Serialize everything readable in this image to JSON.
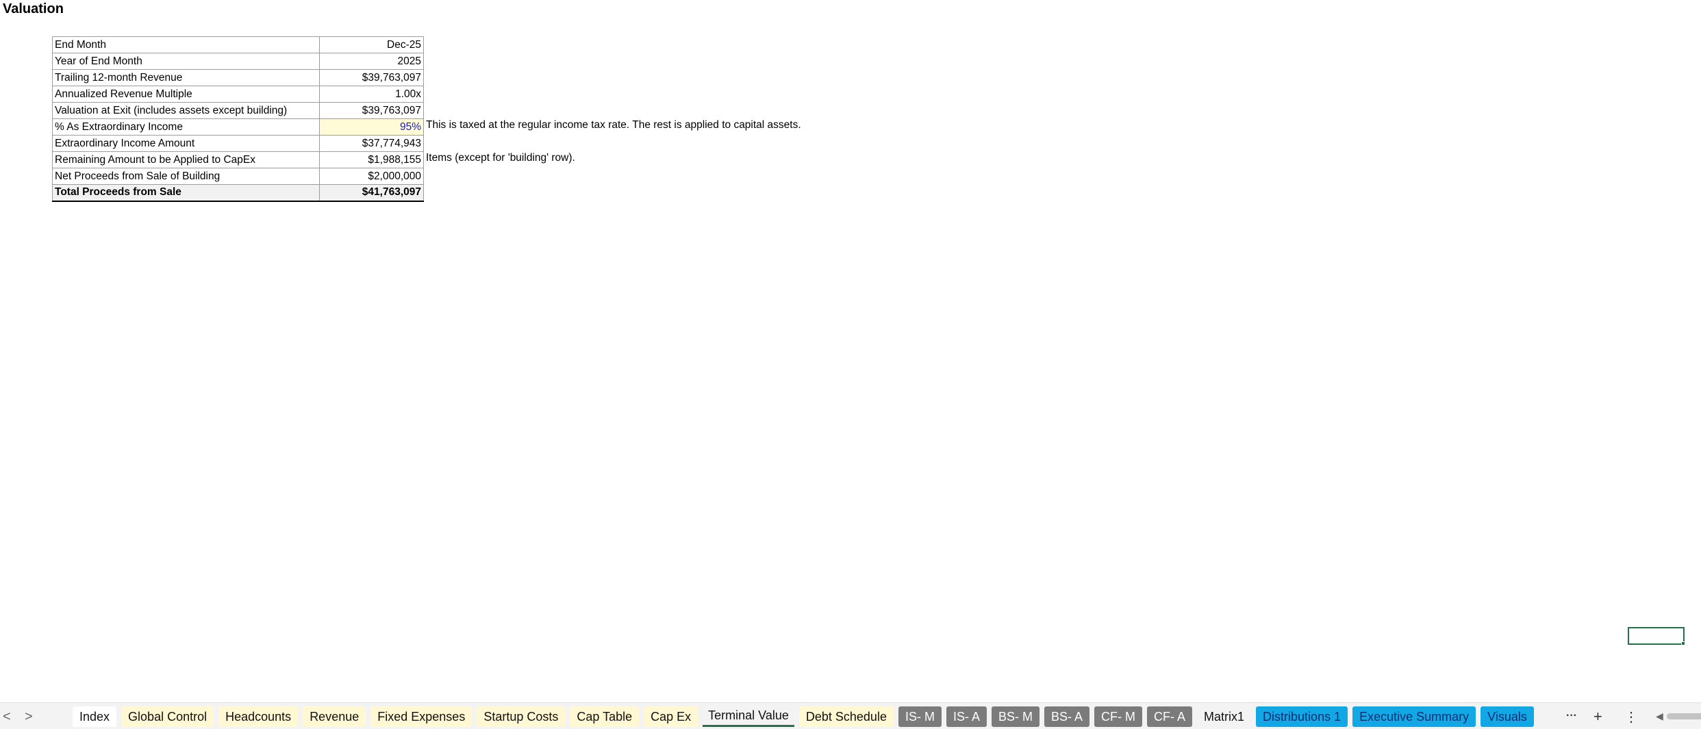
{
  "sheet": {
    "title": "Valuation"
  },
  "valuation": {
    "rows": [
      {
        "label": "End Month",
        "value": "Dec-25"
      },
      {
        "label": "Year of End Month",
        "value": "2025"
      },
      {
        "label": "Trailing 12-month Revenue",
        "value": "$39,763,097"
      },
      {
        "label": "Annualized Revenue Multiple",
        "value": "1.00x"
      },
      {
        "label": "Valuation at Exit (includes assets except building)",
        "value": "$39,763,097"
      },
      {
        "label": "% As Extraordinary Income",
        "value": "95%"
      },
      {
        "label": "Extraordinary Income Amount",
        "value": "$37,774,943"
      },
      {
        "label": "Remaining Amount to be Applied to CapEx",
        "value": "$1,988,155"
      },
      {
        "label": "Net Proceeds from Sale of Building",
        "value": "$2,000,000"
      },
      {
        "label": "Total Proceeds from Sale",
        "value": "$41,763,097"
      }
    ],
    "notes": {
      "extraordinary": "This is taxed at the regular income tax rate. The rest is applied to capital assets.",
      "capex": "Items (except for 'building' row)."
    }
  },
  "nav": {
    "prev": "<",
    "next": ">"
  },
  "tabs": [
    {
      "label": "Index",
      "style": "white"
    },
    {
      "label": "Global Control",
      "style": "yellow"
    },
    {
      "label": "Headcounts",
      "style": "yellow"
    },
    {
      "label": "Revenue",
      "style": "yellow"
    },
    {
      "label": "Fixed Expenses",
      "style": "yellow"
    },
    {
      "label": "Startup Costs",
      "style": "yellow"
    },
    {
      "label": "Cap Table",
      "style": "yellow"
    },
    {
      "label": "Cap Ex",
      "style": "yellow"
    },
    {
      "label": "Terminal Value",
      "style": "active"
    },
    {
      "label": "Debt Schedule",
      "style": "yellow"
    },
    {
      "label": "IS- M",
      "style": "gray"
    },
    {
      "label": "IS- A",
      "style": "gray"
    },
    {
      "label": "BS- M",
      "style": "gray"
    },
    {
      "label": "BS- A",
      "style": "gray"
    },
    {
      "label": "CF- M",
      "style": "gray"
    },
    {
      "label": "CF- A",
      "style": "gray"
    },
    {
      "label": "Matrix1",
      "style": "plain"
    },
    {
      "label": "Distributions 1",
      "style": "blue"
    },
    {
      "label": "Executive Summary",
      "style": "blue"
    },
    {
      "label": "Visuals",
      "style": "blue"
    }
  ],
  "tab_controls": {
    "more": "···",
    "add": "+",
    "options": "⋮"
  },
  "colors": {
    "input_fill": "#fffbd6",
    "input_text": "#1a1ad1",
    "accent": "#217346",
    "gray_tab": "#7b7b7b",
    "blue_tab": "#12a8e6",
    "yellow_tab": "#fff8d2"
  }
}
